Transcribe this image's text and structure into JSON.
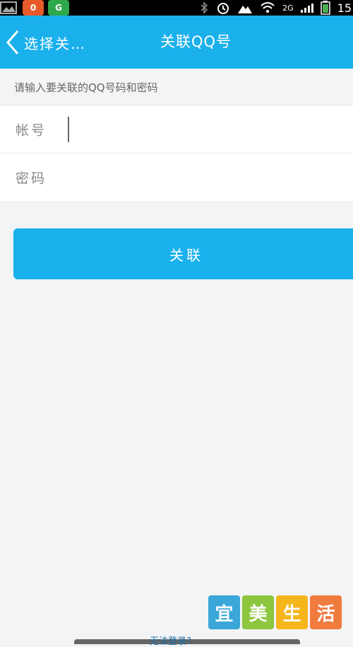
{
  "status_bar": {
    "network": "2G",
    "time": "15",
    "app_icons": [
      {
        "name": "app-icon-orange",
        "color": "#e85a2a",
        "glyph": "0"
      },
      {
        "name": "app-icon-green",
        "color": "#2ea84a",
        "glyph": "G"
      }
    ]
  },
  "navbar": {
    "back_label": "选择关…",
    "title": "关联QQ号",
    "background": "#1ab0ec"
  },
  "hint": "请输入要关联的QQ号码和密码",
  "form": {
    "account_label": "帐号",
    "account_value": "",
    "password_label": "密码",
    "password_value": ""
  },
  "primary_button": {
    "label": "关联",
    "color": "#1ab0ec"
  },
  "watermark": {
    "tiles": [
      {
        "char": "宜",
        "color": "#3aa7d8"
      },
      {
        "char": "美",
        "color": "#8dc63f"
      },
      {
        "char": "生",
        "color": "#f5b51b"
      },
      {
        "char": "活",
        "color": "#f07b3f"
      }
    ]
  },
  "bottom_text": "无法登录?"
}
